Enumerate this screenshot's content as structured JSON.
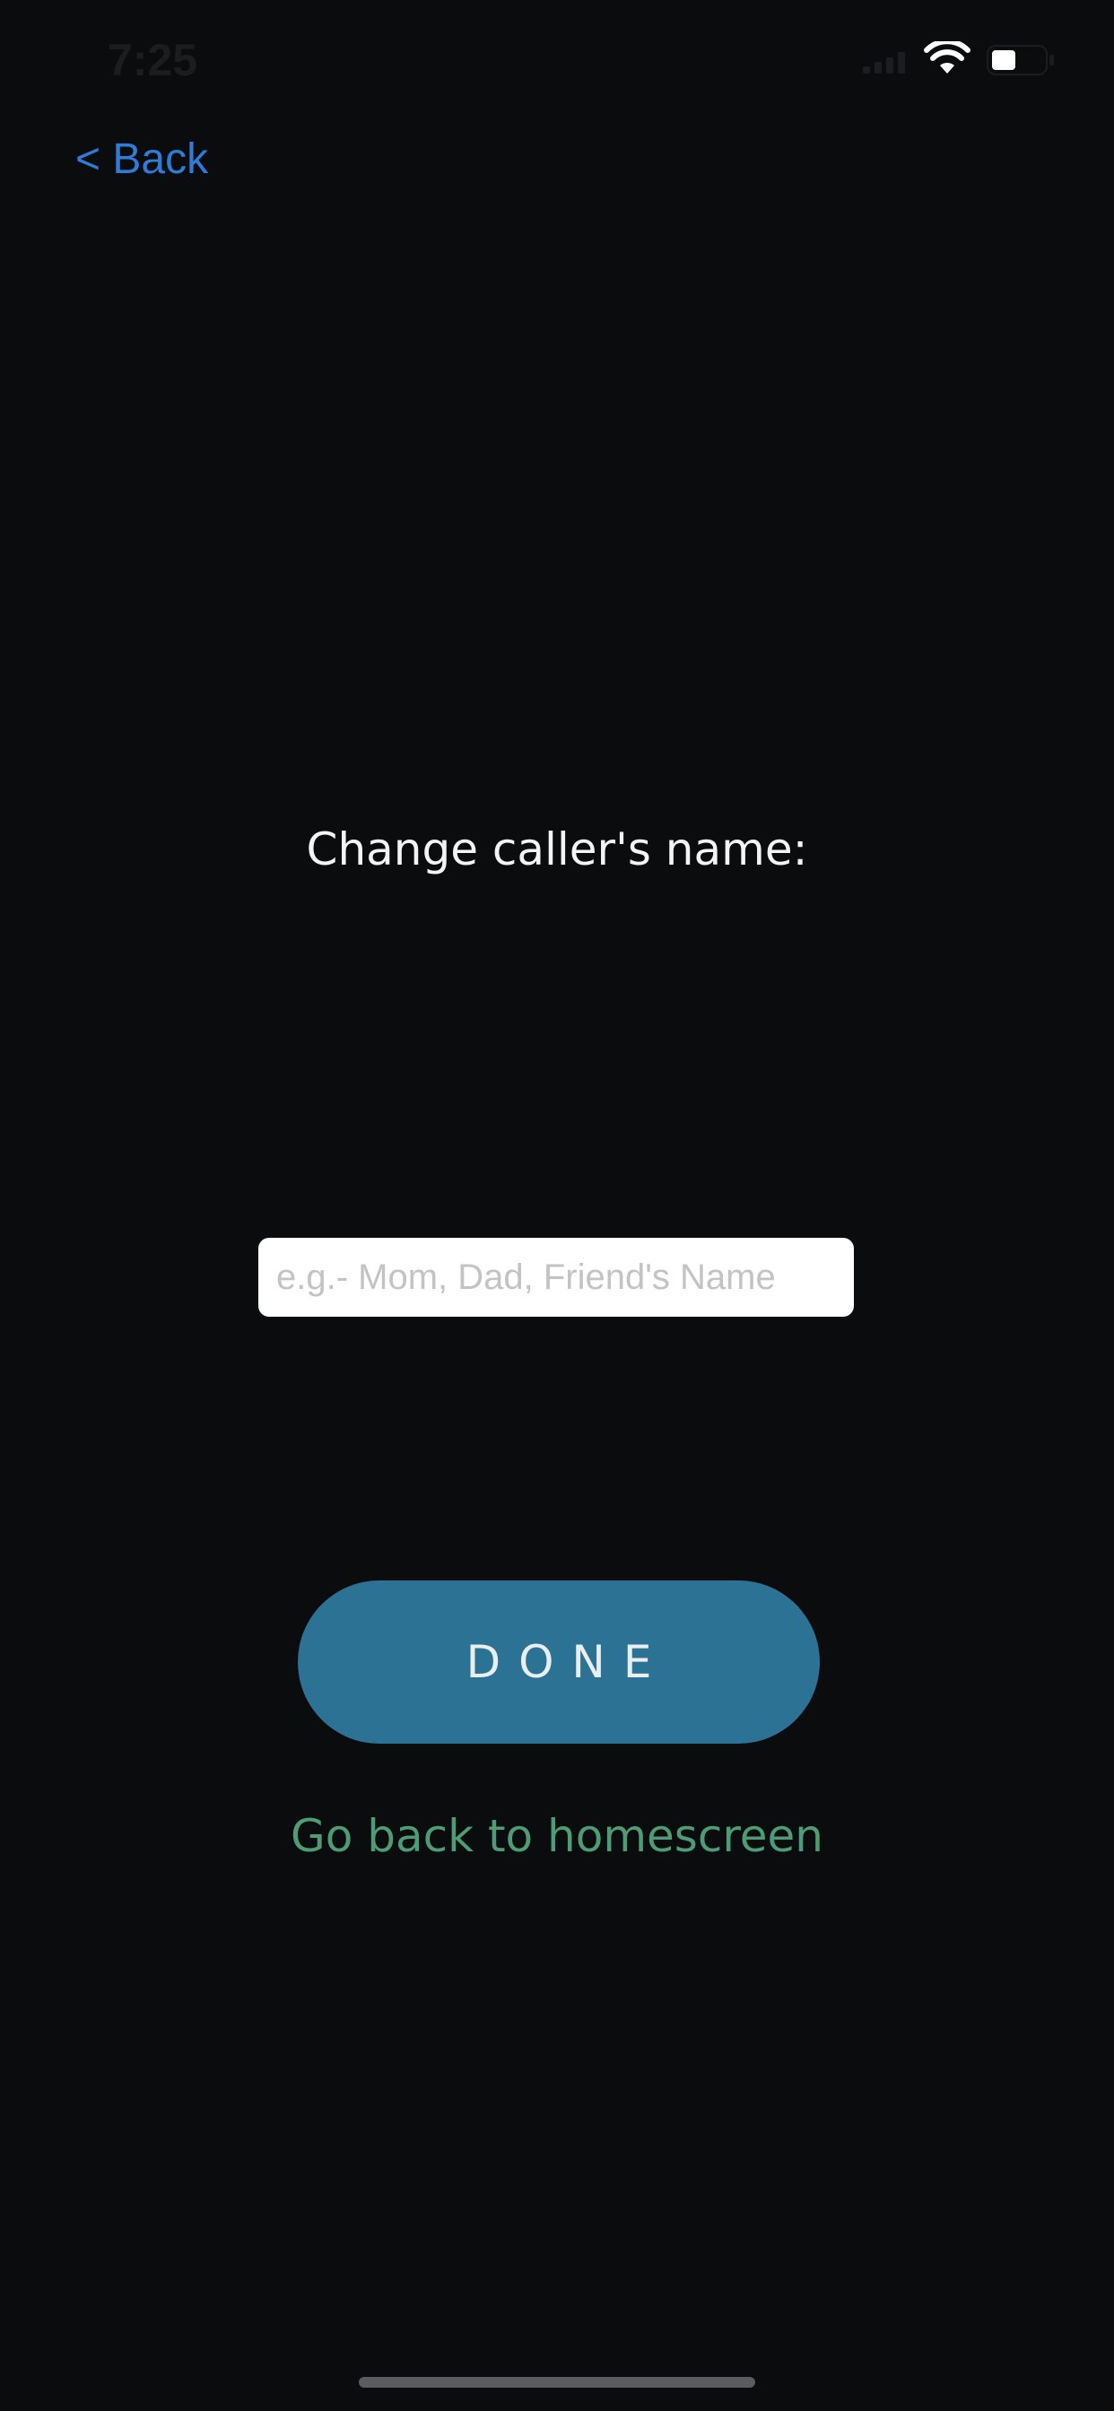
{
  "status_bar": {
    "time": "7:25",
    "icons": [
      "signal-icon",
      "wifi-icon",
      "battery-icon"
    ]
  },
  "nav": {
    "back_label": "< Back"
  },
  "main": {
    "title": "Change caller's name:",
    "name_input": {
      "value": "",
      "placeholder": "e.g.- Mom, Dad, Friend's Name"
    },
    "done_label": "DONE",
    "home_link_label": "Go back to homescreen"
  },
  "colors": {
    "background": "#0b0c0e",
    "back_link": "#2f7bd8",
    "done_button": "#2b7294",
    "home_link": "#4e9c75",
    "title_text": "#f4f4f4"
  }
}
